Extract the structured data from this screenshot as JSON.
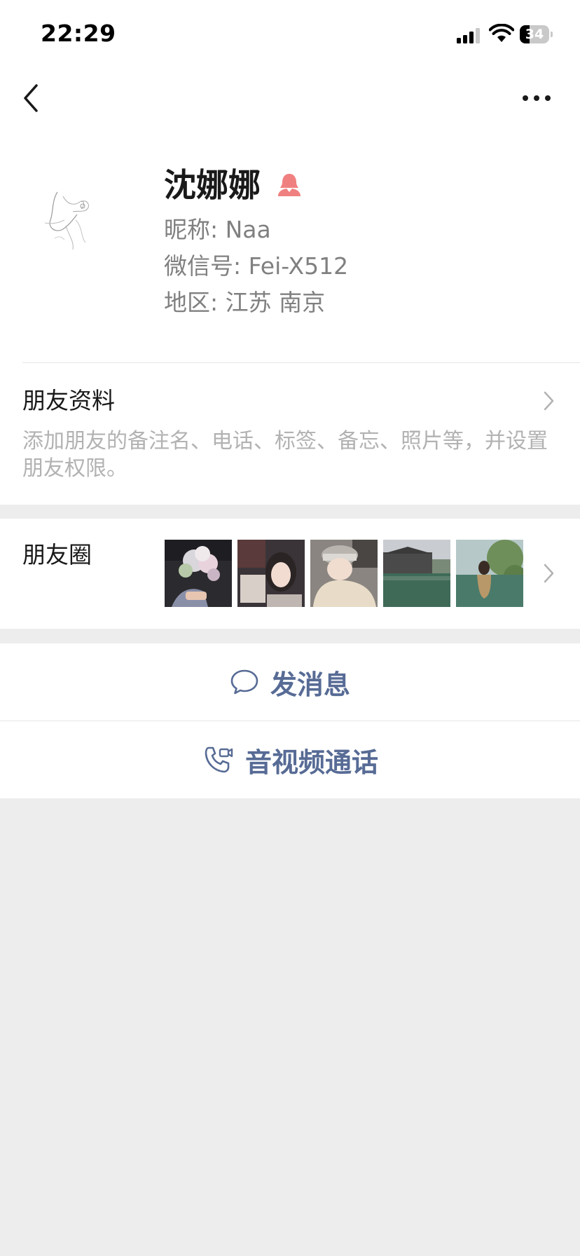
{
  "status_bar": {
    "time": "22:29",
    "battery": "34",
    "battery_level": 0.34
  },
  "nav": {
    "back_icon": "chevron-left-icon",
    "more_icon": "more-dots-icon"
  },
  "profile": {
    "name": "沈娜娜",
    "gender_icon": "female-icon",
    "gender_color": "#fa5151",
    "nickname": "昵称: Naa",
    "wechat_id": "微信号: Fei-X512",
    "region": "地区: 江苏 南京"
  },
  "friend_info": {
    "title": "朋友资料",
    "description": "添加朋友的备注名、电话、标签、备忘、照片等，并设置朋友权限。"
  },
  "moments": {
    "title": "朋友圈",
    "thumbnails": [
      "flower-bouquet-photo",
      "selfie-photo",
      "cap-girl-photo",
      "lake-building-photo",
      "lake-tree-photo"
    ]
  },
  "actions": {
    "message": {
      "label": "发消息",
      "icon": "chat-bubble-icon"
    },
    "call": {
      "label": "音视频通话",
      "icon": "phone-video-icon"
    }
  },
  "colors": {
    "link": "#576b95",
    "background": "#ededed"
  }
}
